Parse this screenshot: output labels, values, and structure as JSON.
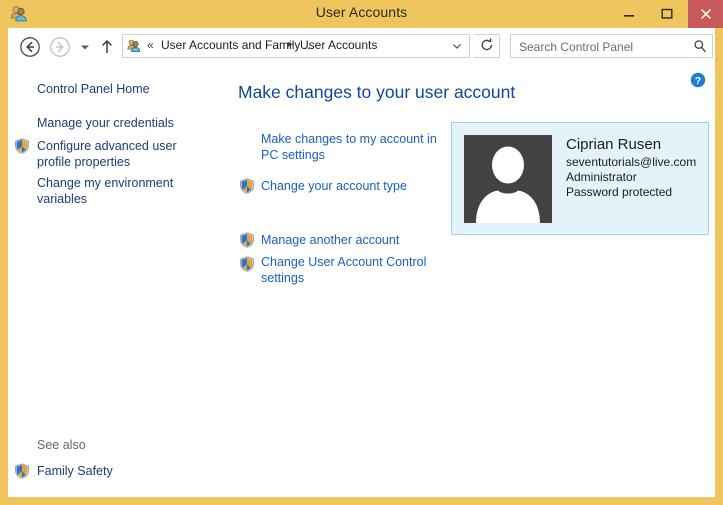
{
  "window": {
    "title": "User Accounts",
    "app_icon": "user-accounts-icon",
    "frame_color": "#eec65d",
    "controls": {
      "minimize_label": "Minimize",
      "maximize_label": "Maximize",
      "close_label": "Close",
      "close_color": "#c75b5b"
    }
  },
  "nav": {
    "back_label": "Back",
    "forward_label": "Forward",
    "recent_label": "Recent locations",
    "up_label": "Up one level",
    "refresh_label": "Refresh",
    "breadcrumb": {
      "icon": "control-panel-icon",
      "overflow": "«",
      "separator": "▸",
      "items": [
        {
          "label": "User Accounts and Family ..."
        },
        {
          "label": "User Accounts"
        }
      ],
      "dropdown_label": "Previous locations"
    },
    "search": {
      "placeholder": "Search Control Panel",
      "value": "",
      "icon": "search-icon"
    }
  },
  "content": {
    "help_label": "Help",
    "help_icon": "help-circle-icon"
  },
  "sidebar": {
    "items": [
      {
        "label": "Control Panel Home",
        "shield": false
      },
      {
        "label": "Manage your credentials",
        "shield": false
      },
      {
        "label": "Configure advanced user profile properties",
        "shield": true
      },
      {
        "label": "Change my environment variables",
        "shield": false
      }
    ],
    "see_also": {
      "title": "See also",
      "items": [
        {
          "label": "Family Safety",
          "shield": true
        }
      ]
    }
  },
  "main": {
    "heading": "Make changes to your user account",
    "links": [
      {
        "label": "Make changes to my account in PC settings",
        "shield": false
      },
      {
        "label": "Change your account type",
        "shield": true
      },
      {
        "label": "Manage another account",
        "shield": true
      },
      {
        "label": "Change User Account Control settings",
        "shield": true
      }
    ]
  },
  "account": {
    "avatar_icon": "user-silhouette-icon",
    "name": "Ciprian Rusen",
    "email": "seventutorials@live.com",
    "account_type": "Administrator",
    "password_status": "Password protected",
    "panel_color": "#e4f3fa",
    "panel_border": "#9fd4e8"
  }
}
